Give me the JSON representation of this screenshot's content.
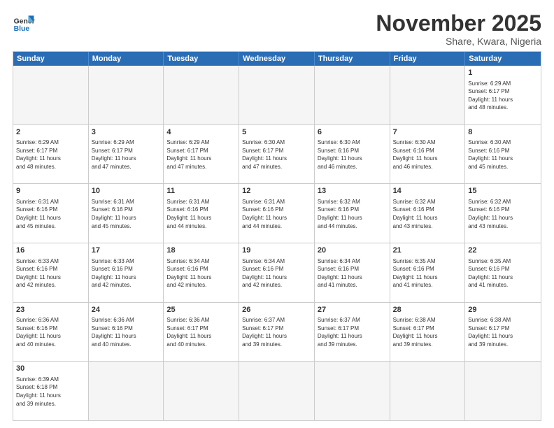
{
  "header": {
    "logo_general": "General",
    "logo_blue": "Blue",
    "month_title": "November 2025",
    "location": "Share, Kwara, Nigeria"
  },
  "days": [
    "Sunday",
    "Monday",
    "Tuesday",
    "Wednesday",
    "Thursday",
    "Friday",
    "Saturday"
  ],
  "rows": [
    [
      {
        "day": "",
        "info": ""
      },
      {
        "day": "",
        "info": ""
      },
      {
        "day": "",
        "info": ""
      },
      {
        "day": "",
        "info": ""
      },
      {
        "day": "",
        "info": ""
      },
      {
        "day": "",
        "info": ""
      },
      {
        "day": "1",
        "info": "Sunrise: 6:29 AM\nSunset: 6:17 PM\nDaylight: 11 hours\nand 48 minutes."
      }
    ],
    [
      {
        "day": "2",
        "info": "Sunrise: 6:29 AM\nSunset: 6:17 PM\nDaylight: 11 hours\nand 48 minutes."
      },
      {
        "day": "3",
        "info": "Sunrise: 6:29 AM\nSunset: 6:17 PM\nDaylight: 11 hours\nand 47 minutes."
      },
      {
        "day": "4",
        "info": "Sunrise: 6:29 AM\nSunset: 6:17 PM\nDaylight: 11 hours\nand 47 minutes."
      },
      {
        "day": "5",
        "info": "Sunrise: 6:30 AM\nSunset: 6:17 PM\nDaylight: 11 hours\nand 47 minutes."
      },
      {
        "day": "6",
        "info": "Sunrise: 6:30 AM\nSunset: 6:16 PM\nDaylight: 11 hours\nand 46 minutes."
      },
      {
        "day": "7",
        "info": "Sunrise: 6:30 AM\nSunset: 6:16 PM\nDaylight: 11 hours\nand 46 minutes."
      },
      {
        "day": "8",
        "info": "Sunrise: 6:30 AM\nSunset: 6:16 PM\nDaylight: 11 hours\nand 45 minutes."
      }
    ],
    [
      {
        "day": "9",
        "info": "Sunrise: 6:31 AM\nSunset: 6:16 PM\nDaylight: 11 hours\nand 45 minutes."
      },
      {
        "day": "10",
        "info": "Sunrise: 6:31 AM\nSunset: 6:16 PM\nDaylight: 11 hours\nand 45 minutes."
      },
      {
        "day": "11",
        "info": "Sunrise: 6:31 AM\nSunset: 6:16 PM\nDaylight: 11 hours\nand 44 minutes."
      },
      {
        "day": "12",
        "info": "Sunrise: 6:31 AM\nSunset: 6:16 PM\nDaylight: 11 hours\nand 44 minutes."
      },
      {
        "day": "13",
        "info": "Sunrise: 6:32 AM\nSunset: 6:16 PM\nDaylight: 11 hours\nand 44 minutes."
      },
      {
        "day": "14",
        "info": "Sunrise: 6:32 AM\nSunset: 6:16 PM\nDaylight: 11 hours\nand 43 minutes."
      },
      {
        "day": "15",
        "info": "Sunrise: 6:32 AM\nSunset: 6:16 PM\nDaylight: 11 hours\nand 43 minutes."
      }
    ],
    [
      {
        "day": "16",
        "info": "Sunrise: 6:33 AM\nSunset: 6:16 PM\nDaylight: 11 hours\nand 42 minutes."
      },
      {
        "day": "17",
        "info": "Sunrise: 6:33 AM\nSunset: 6:16 PM\nDaylight: 11 hours\nand 42 minutes."
      },
      {
        "day": "18",
        "info": "Sunrise: 6:34 AM\nSunset: 6:16 PM\nDaylight: 11 hours\nand 42 minutes."
      },
      {
        "day": "19",
        "info": "Sunrise: 6:34 AM\nSunset: 6:16 PM\nDaylight: 11 hours\nand 42 minutes."
      },
      {
        "day": "20",
        "info": "Sunrise: 6:34 AM\nSunset: 6:16 PM\nDaylight: 11 hours\nand 41 minutes."
      },
      {
        "day": "21",
        "info": "Sunrise: 6:35 AM\nSunset: 6:16 PM\nDaylight: 11 hours\nand 41 minutes."
      },
      {
        "day": "22",
        "info": "Sunrise: 6:35 AM\nSunset: 6:16 PM\nDaylight: 11 hours\nand 41 minutes."
      }
    ],
    [
      {
        "day": "23",
        "info": "Sunrise: 6:36 AM\nSunset: 6:16 PM\nDaylight: 11 hours\nand 40 minutes."
      },
      {
        "day": "24",
        "info": "Sunrise: 6:36 AM\nSunset: 6:16 PM\nDaylight: 11 hours\nand 40 minutes."
      },
      {
        "day": "25",
        "info": "Sunrise: 6:36 AM\nSunset: 6:17 PM\nDaylight: 11 hours\nand 40 minutes."
      },
      {
        "day": "26",
        "info": "Sunrise: 6:37 AM\nSunset: 6:17 PM\nDaylight: 11 hours\nand 39 minutes."
      },
      {
        "day": "27",
        "info": "Sunrise: 6:37 AM\nSunset: 6:17 PM\nDaylight: 11 hours\nand 39 minutes."
      },
      {
        "day": "28",
        "info": "Sunrise: 6:38 AM\nSunset: 6:17 PM\nDaylight: 11 hours\nand 39 minutes."
      },
      {
        "day": "29",
        "info": "Sunrise: 6:38 AM\nSunset: 6:17 PM\nDaylight: 11 hours\nand 39 minutes."
      }
    ],
    [
      {
        "day": "30",
        "info": "Sunrise: 6:39 AM\nSunset: 6:18 PM\nDaylight: 11 hours\nand 39 minutes."
      },
      {
        "day": "",
        "info": ""
      },
      {
        "day": "",
        "info": ""
      },
      {
        "day": "",
        "info": ""
      },
      {
        "day": "",
        "info": ""
      },
      {
        "day": "",
        "info": ""
      },
      {
        "day": "",
        "info": ""
      }
    ]
  ]
}
